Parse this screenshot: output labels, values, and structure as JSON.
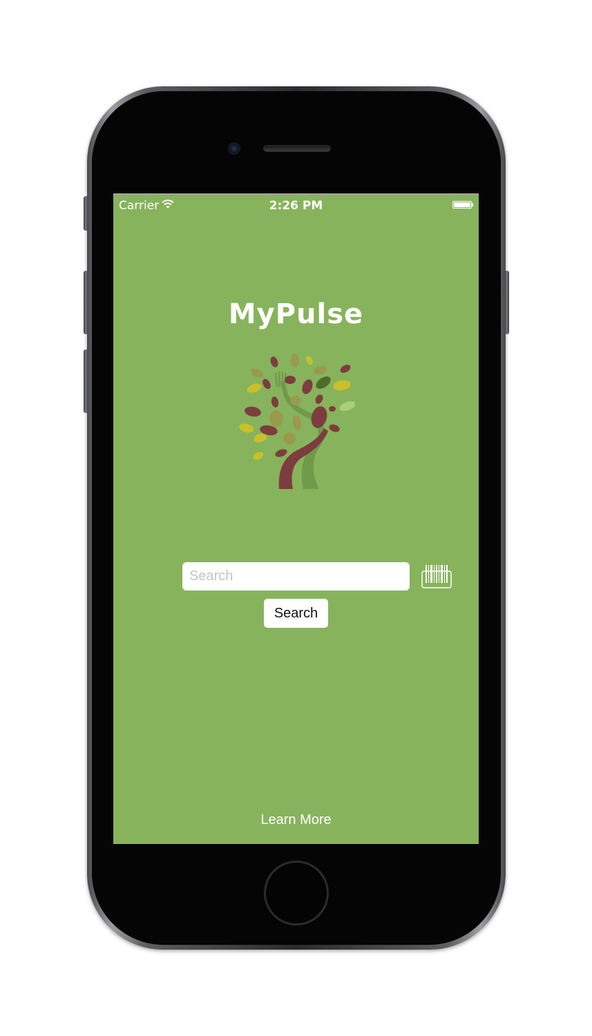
{
  "status_bar": {
    "carrier": "Carrier",
    "time": "2:26 PM"
  },
  "app": {
    "title": "MyPulse",
    "search_placeholder": "Search",
    "search_value": "",
    "search_button_label": "Search",
    "learn_more_label": "Learn More"
  },
  "icons": {
    "barcode": "barcode-scanner-icon",
    "logo": "tree-fork-spoon-logo",
    "wifi": "wifi-icon",
    "battery": "battery-icon"
  },
  "colors": {
    "screen_background": "#87b35c",
    "leaf_maroon": "#7d3d3f",
    "leaf_yellow": "#c8c02a",
    "leaf_olive": "#9a9a4e",
    "leaf_dark_green": "#4f6b2a",
    "trunk_light": "#6e9a4a"
  },
  "battery_level": 1.0
}
